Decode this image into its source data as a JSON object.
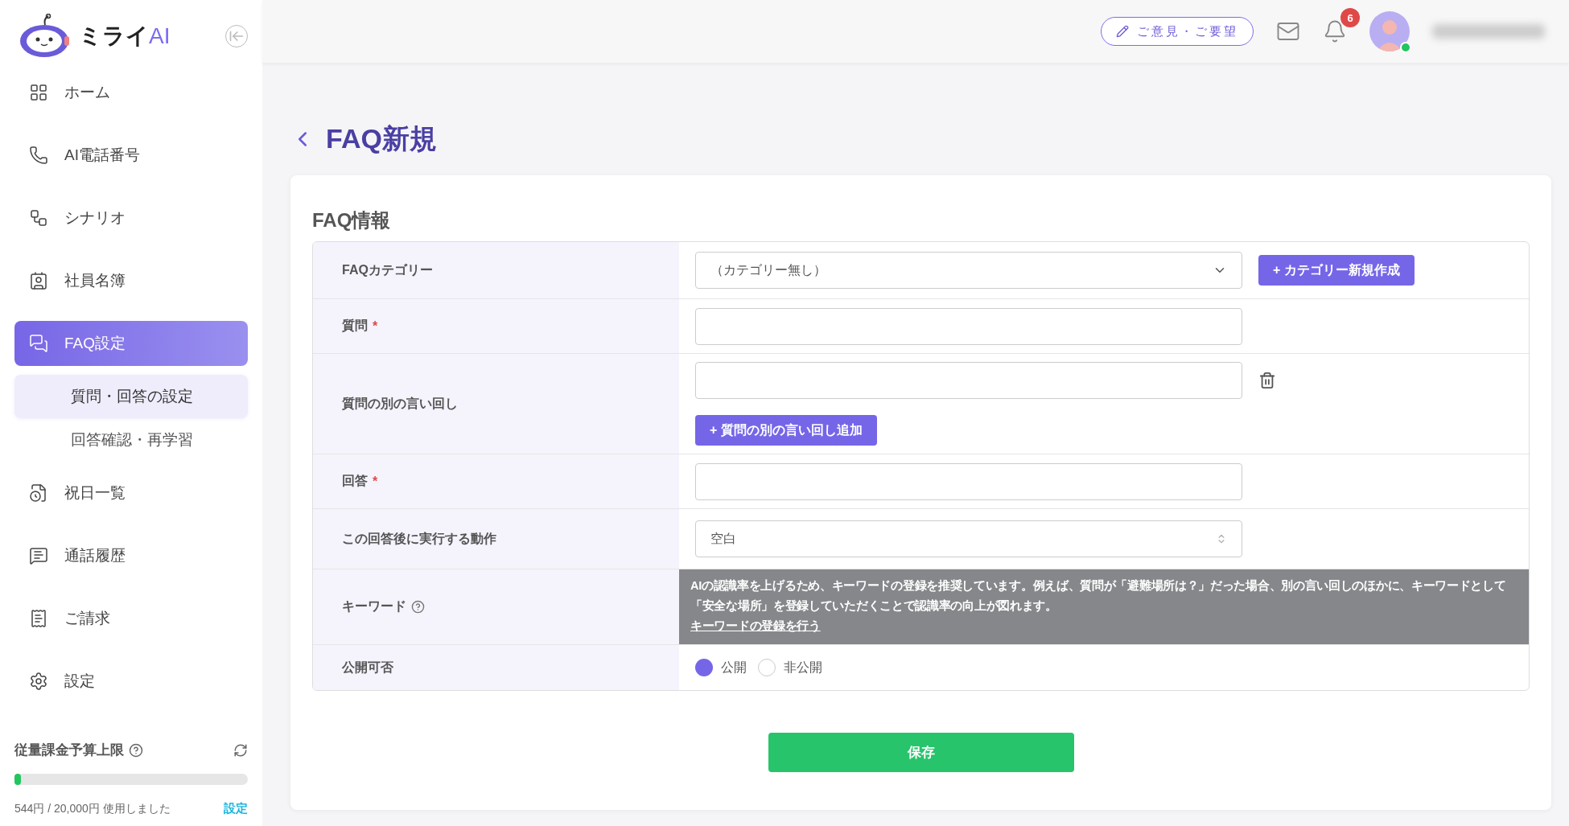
{
  "logo": {
    "text": "ミライ",
    "accent": "AI"
  },
  "sidebar": {
    "items": [
      {
        "label": "ホーム",
        "selected": false
      },
      {
        "label": "AI電話番号",
        "selected": false
      },
      {
        "label": "シナリオ",
        "selected": false
      },
      {
        "label": "社員名簿",
        "selected": false
      },
      {
        "label": "FAQ設定",
        "selected": true,
        "children": [
          {
            "label": "質問・回答の設定",
            "selected": true
          },
          {
            "label": "回答確認・再学習",
            "selected": false
          }
        ]
      },
      {
        "label": "祝日一覧",
        "selected": false
      },
      {
        "label": "通話履歴",
        "selected": false
      },
      {
        "label": "ご請求",
        "selected": false
      },
      {
        "label": "設定",
        "selected": false
      }
    ],
    "budget": {
      "title": "従量課金予算上限",
      "level": 0.027,
      "usage": "544円 / 20,000円 使用しました",
      "link": "設定"
    }
  },
  "header": {
    "feedback_button": "ご意見・ご要望",
    "notification_count": "6",
    "online": true
  },
  "page": {
    "title": "FAQ新規",
    "section_title": "FAQ情報",
    "rows": [
      {
        "kind": "select",
        "label": "FAQカテゴリー",
        "value": "（カテゴリー無し）",
        "button": "+ カテゴリー新規作成"
      },
      {
        "kind": "input",
        "label": "質問",
        "required_mark": "*"
      },
      {
        "kind": "alternates",
        "label": "質問の別の言い回し",
        "button": "+ 質問の別の言い回し追加"
      },
      {
        "kind": "input",
        "label": "回答",
        "required_mark": "*"
      },
      {
        "kind": "native-select",
        "label": "この回答後に実行する動作",
        "value": "空白"
      },
      {
        "kind": "tooltip",
        "label": "キーワード",
        "help": true,
        "lines": [
          "AIの認識率を上げるため、キーワードの登録を推奨しています。例えば、質問が「避難場所は？」だった場合、別の言い回しのほかに、キーワードとして",
          "「安全な場所」を登録していただくことで認識率の向上が図れます。"
        ],
        "link": "キーワードの登録を行う"
      },
      {
        "kind": "radio",
        "label": "公開可否",
        "options": [
          {
            "label": "公開",
            "selected": true
          },
          {
            "label": "非公開",
            "selected": false
          }
        ]
      }
    ],
    "save_button": "保存"
  }
}
